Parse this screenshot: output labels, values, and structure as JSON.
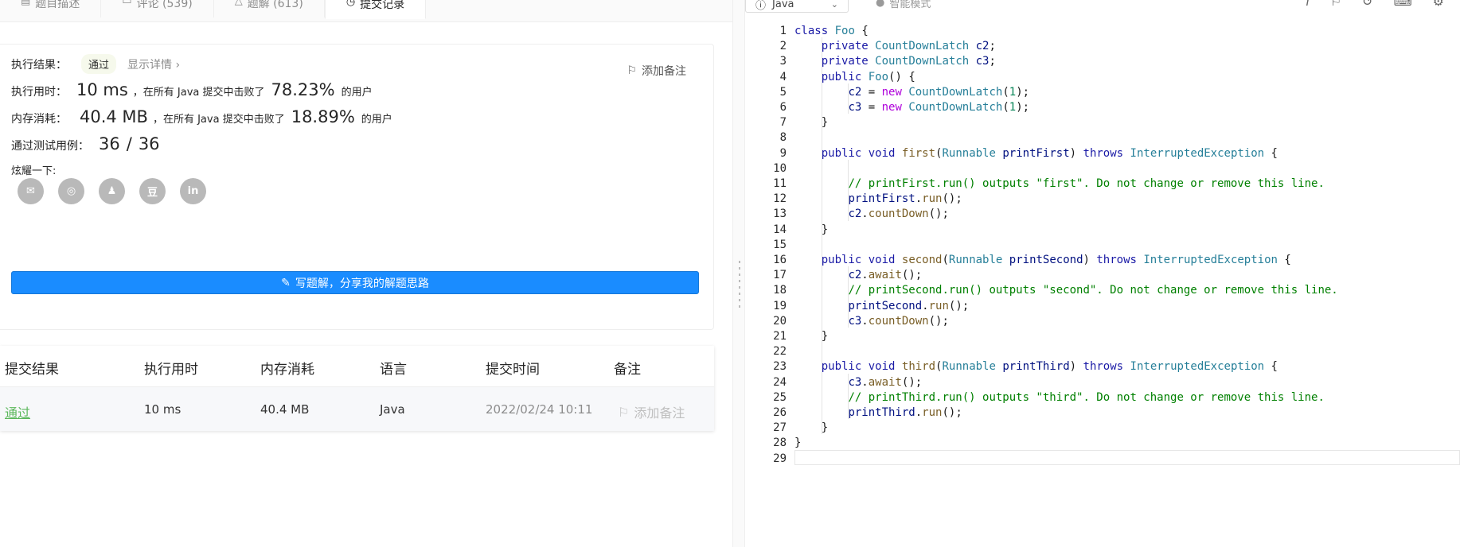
{
  "tabs": [
    {
      "label": "题目描述",
      "icon": "description-icon"
    },
    {
      "label": "评论 (539)",
      "icon": "comment-icon"
    },
    {
      "label": "题解 (613)",
      "icon": "solution-icon"
    },
    {
      "label": "提交记录",
      "icon": "clock-icon"
    }
  ],
  "result": {
    "exec_label": "执行结果：",
    "status": "通过",
    "detail_link": "显示详情 ›",
    "add_note": "添加备注",
    "time_label": "执行用时：",
    "time_value": "10 ms",
    "time_text": "，在所有 Java 提交中击败了",
    "time_percent": "78.23%",
    "users_text": "的用户",
    "mem_label": "内存消耗：",
    "mem_value": "40.4 MB",
    "mem_text": "，在所有 Java 提交中击败了",
    "mem_percent": "18.89%",
    "tests_label": "通过测试用例：",
    "tests_passed": "36",
    "tests_sep": "/",
    "tests_total": "36",
    "share_label": "炫耀一下:",
    "share_icons": [
      "wechat-icon",
      "weibo-icon",
      "qq-icon",
      "douban-icon",
      "linkedin-icon"
    ],
    "share_glyphs": [
      "✉",
      "◎",
      "♟",
      "豆",
      "in"
    ],
    "write_button": "写题解，分享我的解题思路"
  },
  "submissions": {
    "headers": [
      "提交结果",
      "执行用时",
      "内存消耗",
      "语言",
      "提交时间",
      "备注"
    ],
    "rows": [
      {
        "result": "通过",
        "time": "10 ms",
        "memory": "40.4 MB",
        "language": "Java",
        "submitted": "2022/02/24 10:11",
        "note": "添加备注"
      }
    ]
  },
  "editor": {
    "language": "Java",
    "smart_mode": "智能模式",
    "lines": [
      "class Foo {",
      "    private CountDownLatch c2;",
      "    private CountDownLatch c3;",
      "    public Foo() {",
      "        c2 = new CountDownLatch(1);",
      "        c3 = new CountDownLatch(1);",
      "    }",
      "",
      "    public void first(Runnable printFirst) throws InterruptedException {",
      "",
      "        // printFirst.run() outputs \"first\". Do not change or remove this line.",
      "        printFirst.run();",
      "        c2.countDown();",
      "    }",
      "",
      "    public void second(Runnable printSecond) throws InterruptedException {",
      "        c2.await();",
      "        // printSecond.run() outputs \"second\". Do not change or remove this line.",
      "        printSecond.run();",
      "        c3.countDown();",
      "    }",
      "",
      "    public void third(Runnable printThird) throws InterruptedException {",
      "        c3.await();",
      "        // printThird.run() outputs \"third\". Do not change or remove this line.",
      "        printThird.run();",
      "    }",
      "}",
      ""
    ]
  },
  "colors": {
    "accent": "#1a8cff",
    "pass": "#5cb85c",
    "comment": "#008000",
    "keyword": "#1a1aa6",
    "type": "#267f99"
  }
}
